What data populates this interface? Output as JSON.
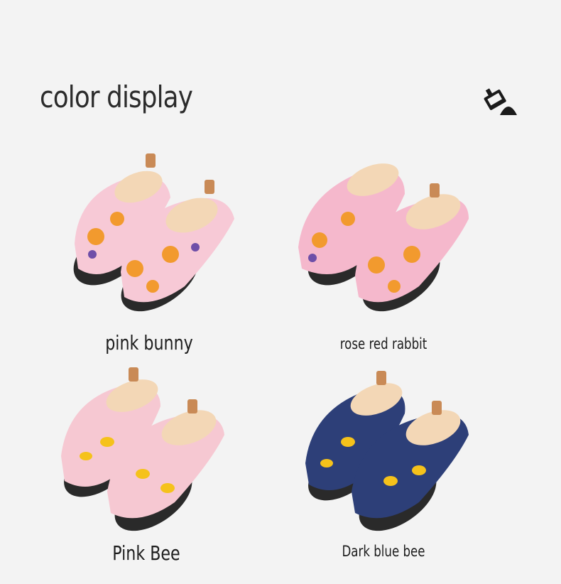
{
  "header": {
    "title": "color display",
    "icon": "paint-bucket-icon"
  },
  "variants": [
    {
      "name": "pink bunny",
      "body_color": "#f7c9d6",
      "print": "bunny"
    },
    {
      "name": "rose red rabbit",
      "body_color": "#f5b8cc",
      "print": "bunny"
    },
    {
      "name": "Pink Bee",
      "body_color": "#f6c8d2",
      "print": "bee"
    },
    {
      "name": "Dark blue bee",
      "body_color": "#2d3f78",
      "print": "bee"
    }
  ],
  "colors": {
    "background": "#f3f3f3",
    "lining": "#f3d7b6",
    "sole": "#2a2a2a",
    "tab": "#c98a56",
    "accent_orange": "#f29a2e"
  }
}
